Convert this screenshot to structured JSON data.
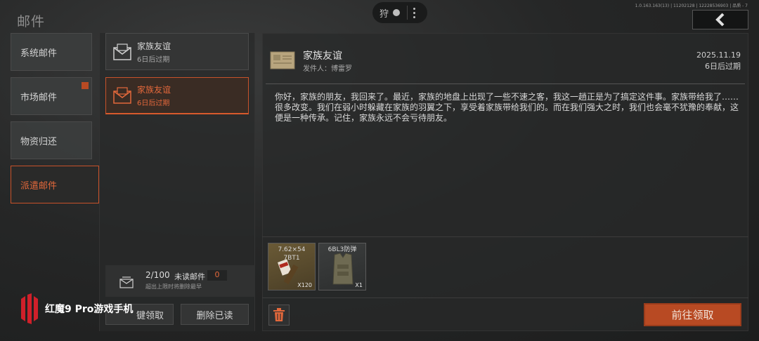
{
  "header": {
    "title": "邮件",
    "version": "1.0.163.163(13) | 11202128 | 12228536903 | 品质 - 7",
    "hunt_label": "狩"
  },
  "categories": [
    {
      "label": "系统邮件",
      "active": false
    },
    {
      "label": "市场邮件",
      "active": false,
      "badge": true
    },
    {
      "label": "物资归还",
      "active": false
    },
    {
      "label": "派遣邮件",
      "active": true
    }
  ],
  "mail_list": [
    {
      "title": "家族友谊",
      "expiry": "6日后过期",
      "active": false
    },
    {
      "title": "家族友谊",
      "expiry": "6日后过期",
      "active": true
    }
  ],
  "mail_counter": {
    "count": "2/100",
    "unread_label": "未读邮件",
    "unread_count": "0",
    "hint": "超出上限时将删除最早"
  },
  "bottom_buttons": {
    "claim_all": "键领取",
    "delete_read": "删除已读"
  },
  "detail": {
    "subject": "家族友谊",
    "sender": "发件人：博雷罗",
    "date": "2025.11.19",
    "expiry": "6日后过期",
    "body": "你好，家族的朋友，我回来了。最近，家族的地盘上出现了一些不速之客，我这一趟正是为了搞定这件事。家族带给我了……很多改变。我们在弱小时躲藏在家族的羽翼之下，享受着家族带给我们的。而在我们强大之时，我们也会毫不犹豫的奉献，这便是一种传承。记住，家族永远不会亏待朋友。",
    "attachments": [
      {
        "name": "7.62×54\n7BT1",
        "qty": "X120"
      },
      {
        "name": "6BL3防弹",
        "qty": "X1"
      }
    ],
    "claim_button": "前往领取"
  },
  "watermark": {
    "text": "红魔9 Pro游戏手机"
  },
  "colors": {
    "accent": "#e3683b",
    "button": "#b84a23"
  }
}
